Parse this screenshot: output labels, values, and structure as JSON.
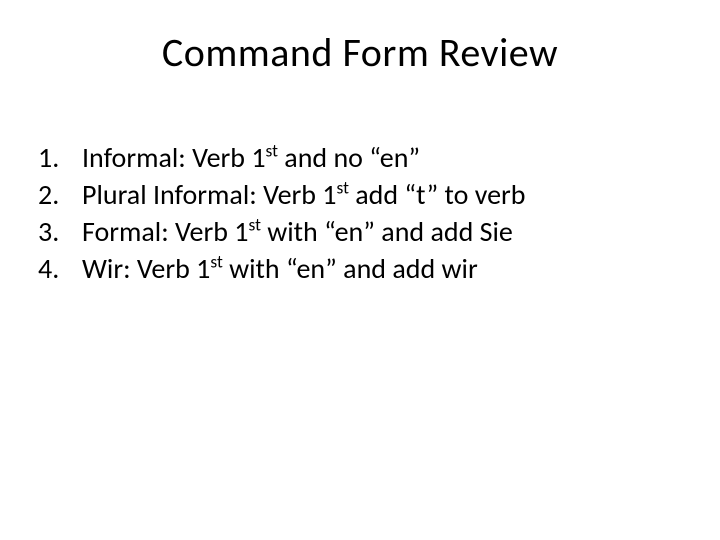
{
  "title": "Command Form Review",
  "items": [
    {
      "n": "1.",
      "pre": "Informal: Verb 1",
      "sup": "st",
      "post": " and no “en”"
    },
    {
      "n": "2.",
      "pre": "Plural Informal: Verb 1",
      "sup": "st",
      "post": " add “t” to verb"
    },
    {
      "n": "3.",
      "pre": "Formal: Verb 1",
      "sup": "st",
      "post": " with “en” and add Sie"
    },
    {
      "n": "4.",
      "pre": "Wir: Verb 1",
      "sup": "st",
      "post": " with “en” and add wir"
    }
  ]
}
